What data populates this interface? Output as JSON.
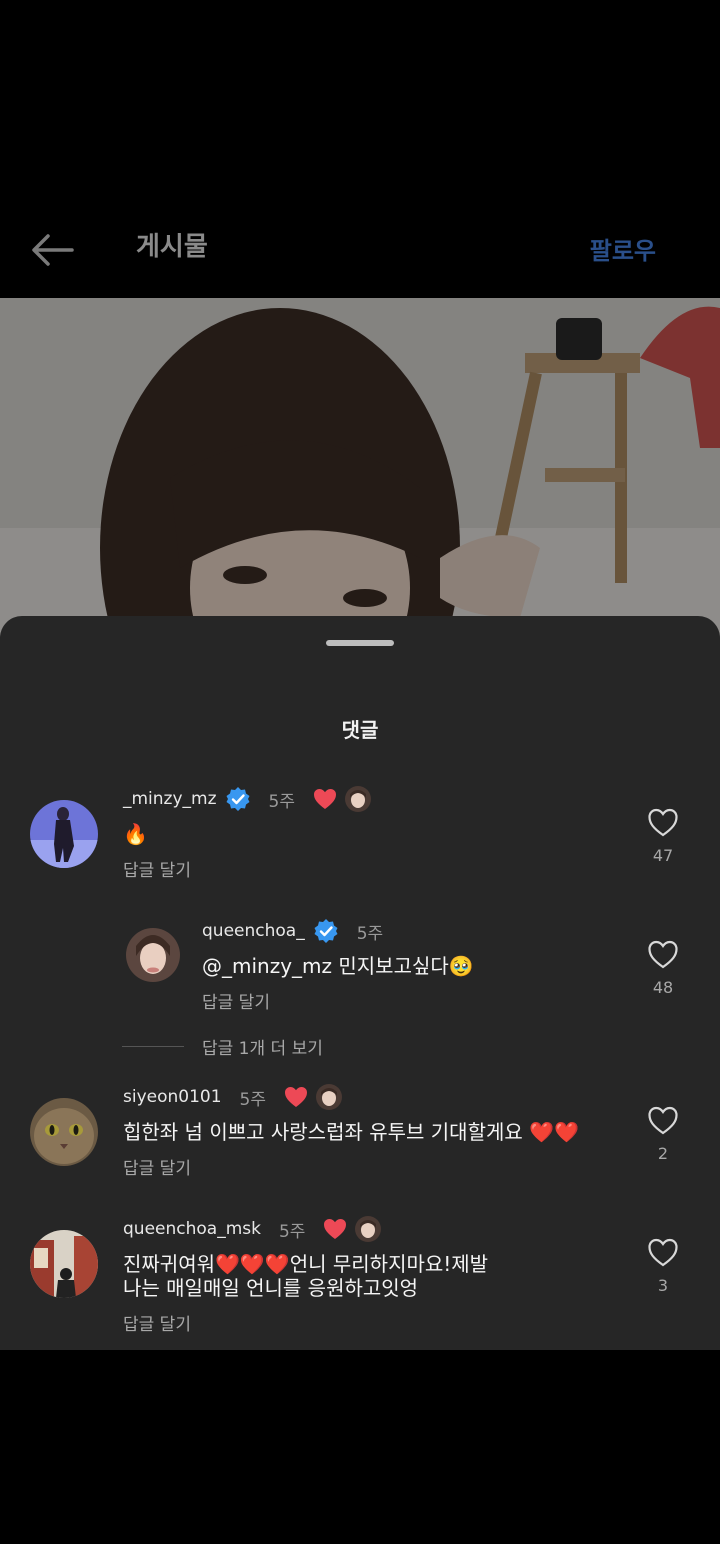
{
  "header": {
    "title": "게시물",
    "follow_label": "팔로우"
  },
  "sheet": {
    "title": "댓글"
  },
  "colors": {
    "sheet_bg": "#262626",
    "verified_blue": "#3897f0",
    "heart_red": "#ed4956",
    "follow_blue": "#2a4f8a"
  },
  "comments": [
    {
      "username": "_minzy_mz",
      "verified": true,
      "time": "5주",
      "liked_by_author": true,
      "text": "🔥",
      "reply_label": "답글 달기",
      "likes": "47"
    },
    {
      "username": "queenchoa_",
      "verified": true,
      "time": "5주",
      "liked_by_author": false,
      "text": "@_minzy_mz 민지보고싶다🥹",
      "reply_label": "답글 달기",
      "likes": "48"
    },
    {
      "username": "siyeon0101",
      "verified": false,
      "time": "5주",
      "liked_by_author": true,
      "text": "힙한좌 넘 이쁘고 사랑스럽좌 유투브 기대할게요 ❤️❤️",
      "reply_label": "답글 달기",
      "likes": "2"
    },
    {
      "username": "queenchoa_msk",
      "verified": false,
      "time": "5주",
      "liked_by_author": true,
      "text": "진짜귀여워❤️❤️❤️언니 무리하지마요!제발\n나는 매일매일 언니를 응원하고잇엉",
      "reply_label": "답글 달기",
      "likes": "3"
    }
  ],
  "view_more_replies": "답글 1개 더 보기",
  "icons": {
    "back": "arrow-left-icon",
    "verified": "verified-badge-icon",
    "heart_filled": "heart-filled-icon",
    "heart_outline": "heart-outline-icon"
  }
}
